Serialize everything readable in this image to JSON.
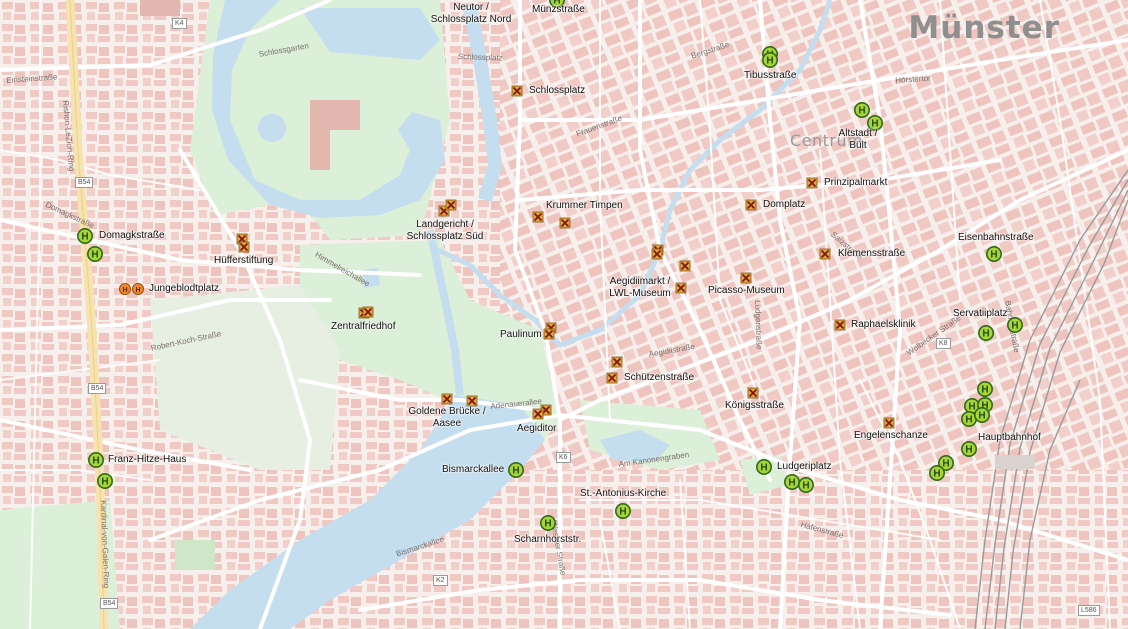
{
  "city_label": "Münster",
  "district_label": "Centrum",
  "stops": [
    {
      "key": "muenzstrasse",
      "label": "Münzstraße"
    },
    {
      "key": "neutor",
      "label": "Neutor / Schlossplatz Nord"
    },
    {
      "key": "tibusstrasse",
      "label": "Tibusstraße"
    },
    {
      "key": "schlossplatz",
      "label": "Schlossplatz"
    },
    {
      "key": "altstadt",
      "label": "Altstadt / Bült"
    },
    {
      "key": "prinzipalmarkt",
      "label": "Prinzipalmarkt"
    },
    {
      "key": "krummer_timpen",
      "label": "Krummer Timpen"
    },
    {
      "key": "domplatz",
      "label": "Domplatz"
    },
    {
      "key": "domagkstrasse",
      "label": "Domagkstraße"
    },
    {
      "key": "landgericht",
      "label": "Landgericht / Schlossplatz Süd"
    },
    {
      "key": "eisenbahnstrasse",
      "label": "Eisenbahnstraße"
    },
    {
      "key": "huefferstiftung",
      "label": "Hüfferstiftung"
    },
    {
      "key": "klemensstrasse",
      "label": "Klemensstraße"
    },
    {
      "key": "jungeblodtplatz",
      "label": "Jungeblodtplatz"
    },
    {
      "key": "aegidiimarkt",
      "label": "Aegidiimarkt / LWL-Museum"
    },
    {
      "key": "picasso",
      "label": "Picasso-Museum"
    },
    {
      "key": "servatiiplatz",
      "label": "Servatiiplatz"
    },
    {
      "key": "zentralfriedhof",
      "label": "Zentralfriedhof"
    },
    {
      "key": "raphaelsklinik",
      "label": "Raphaelsklinik"
    },
    {
      "key": "paulinum",
      "label": "Paulinum"
    },
    {
      "key": "schuetzenstrasse",
      "label": "Schützenstraße"
    },
    {
      "key": "koenigsstrasse",
      "label": "Königsstraße"
    },
    {
      "key": "goldene_bruecke",
      "label": "Goldene Brücke / Aasee"
    },
    {
      "key": "aegiditor",
      "label": "Aegiditor"
    },
    {
      "key": "engelenschanze",
      "label": "Engelenschanze"
    },
    {
      "key": "hauptbahnhof",
      "label": "Hauptbahnhof"
    },
    {
      "key": "franz_hitze",
      "label": "Franz-Hitze-Haus"
    },
    {
      "key": "bismarckallee",
      "label": "Bismarckallee"
    },
    {
      "key": "ludgeriplatz",
      "label": "Ludgeriplatz"
    },
    {
      "key": "st_antonius",
      "label": "St.-Antonius-Kirche"
    },
    {
      "key": "scharnhorststr",
      "label": "Scharnhorststr."
    }
  ],
  "road_labels": [
    {
      "key": "einsteinstrasse",
      "label": "Einsteinstraße"
    },
    {
      "key": "domagkstr_street",
      "label": "Domagkstraße"
    },
    {
      "key": "schlossgarten",
      "label": "Schlossgarten"
    },
    {
      "key": "schlossplatz_street",
      "label": "Schlossplatz"
    },
    {
      "key": "robert_koch",
      "label": "Robert-Koch-Straße"
    },
    {
      "key": "himmelreichallee",
      "label": "Himmelreichallee"
    },
    {
      "key": "adenauerallee",
      "label": "Adenauerallee"
    },
    {
      "key": "bismarckallee_street",
      "label": "Bismarckallee"
    },
    {
      "key": "hafenstrasse",
      "label": "Hafenstraße"
    },
    {
      "key": "am_kanonengraben",
      "label": "Am Kanonengraben"
    },
    {
      "key": "wolbecker",
      "label": "Wolbecker Straße"
    },
    {
      "key": "bahnhofstrasse",
      "label": "Bahnhofstraße"
    },
    {
      "key": "kardinal_von_galen",
      "label": "Kardinal-von-Galen-Ring"
    },
    {
      "key": "rishon_lezion_ring",
      "label": "Rishon-LeZion-Ring"
    },
    {
      "key": "frauenstrasse",
      "label": "Frauenstraße"
    },
    {
      "key": "salzstrasse",
      "label": "Salzstraße"
    },
    {
      "key": "ludgeristrasse",
      "label": "Ludgeristraße"
    },
    {
      "key": "weseler",
      "label": "Weseler Straße"
    },
    {
      "key": "aegidiistrasse",
      "label": "Aegidiistraße"
    },
    {
      "key": "hoerstertor",
      "label": "Hörstertor"
    },
    {
      "key": "bergstrasse",
      "label": "Bergstraße"
    }
  ],
  "road_refs": [
    "K4",
    "B54",
    "B54",
    "B54",
    "K2",
    "K6",
    "K8",
    "L586"
  ],
  "legend_icons": {
    "bus_stop": "bus-stop-H-icon",
    "closed_stop": "closed-stop-x-icon",
    "temporary_stop": "temporary-stop-H-icon"
  },
  "colors": {
    "background": "#f6efec",
    "building": "#f0c9c4",
    "park": "#dcefd8",
    "water": "#c4def0",
    "road": "#ffffff",
    "major_road": "#f7e3b0",
    "bus_stop_fill": "#a8d43a",
    "bus_stop_ring": "#2d6b1a",
    "closed_stop_fill": "#e8a43a",
    "temporary_stop_fill": "#ef8b2c"
  }
}
